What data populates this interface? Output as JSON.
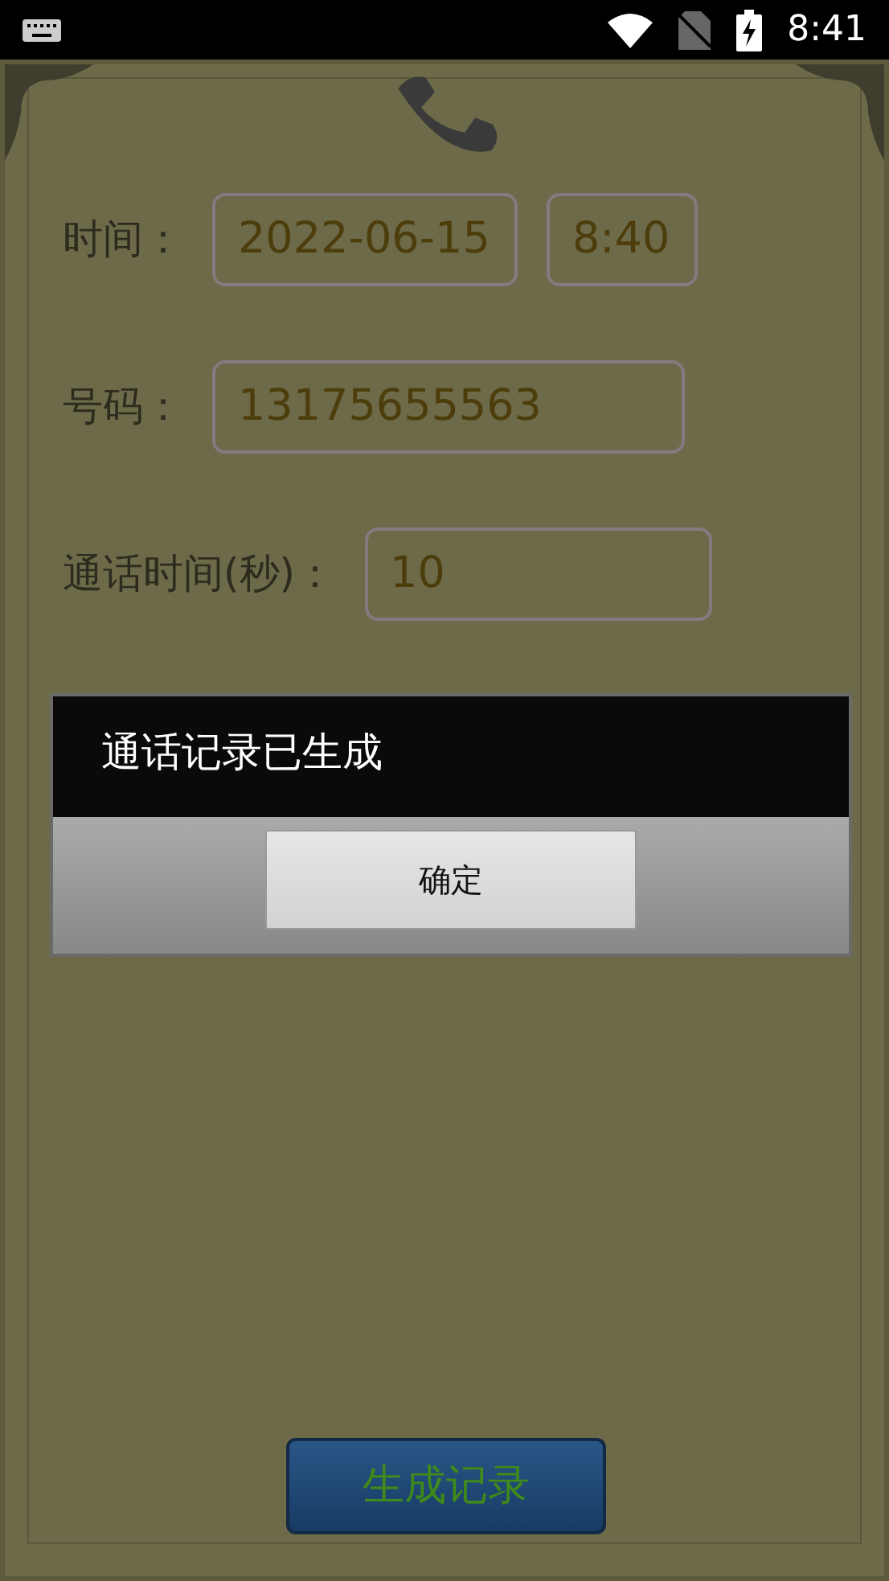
{
  "status_bar": {
    "time": "8:41"
  },
  "form": {
    "rows": [
      {
        "label": "时间：",
        "fields": [
          "2022-06-15",
          "8:40"
        ]
      },
      {
        "label": "号码：",
        "fields": [
          "13175655563"
        ]
      },
      {
        "label": "通话时间(秒)：",
        "fields": [
          "10"
        ]
      }
    ]
  },
  "submit_button": "生成记录",
  "dialog": {
    "message": "通话记录已生成",
    "button": "确定"
  }
}
